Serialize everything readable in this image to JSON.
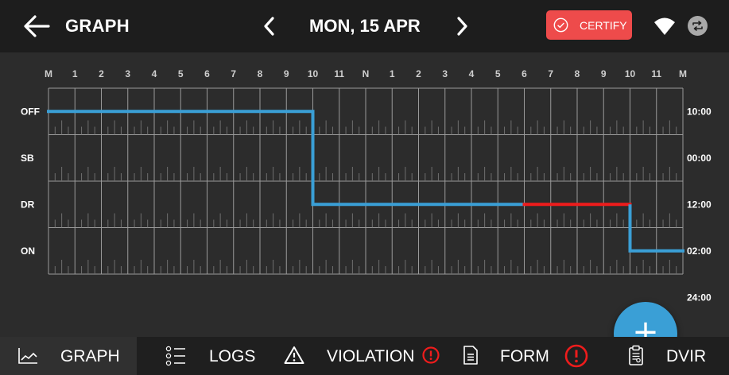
{
  "header": {
    "title": "GRAPH",
    "date": "MON, 15 APR",
    "certify_label": "CERTIFY"
  },
  "chart_data": {
    "type": "line",
    "x_ticks": [
      "M",
      "1",
      "2",
      "3",
      "4",
      "5",
      "6",
      "7",
      "8",
      "9",
      "10",
      "11",
      "N",
      "1",
      "2",
      "3",
      "4",
      "5",
      "6",
      "7",
      "8",
      "9",
      "10",
      "11",
      "M"
    ],
    "statuses": [
      "OFF",
      "SB",
      "DR",
      "ON"
    ],
    "totals": [
      "10:00",
      "00:00",
      "12:00",
      "02:00",
      "24:00"
    ],
    "segments": [
      {
        "status": "OFF",
        "start": 0,
        "end": 10,
        "violation": false
      },
      {
        "status": "DR",
        "start": 10,
        "end": 18,
        "violation": false
      },
      {
        "status": "DR",
        "start": 18,
        "end": 22,
        "violation": true
      },
      {
        "status": "ON",
        "start": 22,
        "end": 24,
        "violation": false
      }
    ],
    "colors": {
      "line": "#3a9fd6",
      "violation": "#ee1c1c",
      "grid": "#9a9a9a"
    }
  },
  "nav": {
    "graph": "GRAPH",
    "logs": "LOGS",
    "violation": "VIOLATION",
    "form": "FORM",
    "dvir": "DVIR"
  },
  "colors": {
    "accent": "#3a9fd6",
    "alert": "#ee4b4b",
    "topbar": "#1d1d1d"
  }
}
